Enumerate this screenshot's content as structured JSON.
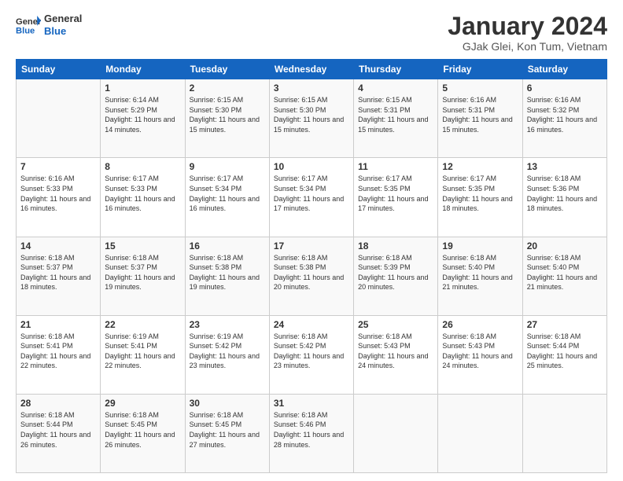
{
  "logo": {
    "line1": "General",
    "line2": "Blue"
  },
  "header": {
    "title": "January 2024",
    "subtitle": "GJak Glei, Kon Tum, Vietnam"
  },
  "weekdays": [
    "Sunday",
    "Monday",
    "Tuesday",
    "Wednesday",
    "Thursday",
    "Friday",
    "Saturday"
  ],
  "weeks": [
    [
      {
        "day": "",
        "sunrise": "",
        "sunset": "",
        "daylight": ""
      },
      {
        "day": "1",
        "sunrise": "6:14 AM",
        "sunset": "5:29 PM",
        "daylight": "11 hours and 14 minutes."
      },
      {
        "day": "2",
        "sunrise": "6:15 AM",
        "sunset": "5:30 PM",
        "daylight": "11 hours and 15 minutes."
      },
      {
        "day": "3",
        "sunrise": "6:15 AM",
        "sunset": "5:30 PM",
        "daylight": "11 hours and 15 minutes."
      },
      {
        "day": "4",
        "sunrise": "6:15 AM",
        "sunset": "5:31 PM",
        "daylight": "11 hours and 15 minutes."
      },
      {
        "day": "5",
        "sunrise": "6:16 AM",
        "sunset": "5:31 PM",
        "daylight": "11 hours and 15 minutes."
      },
      {
        "day": "6",
        "sunrise": "6:16 AM",
        "sunset": "5:32 PM",
        "daylight": "11 hours and 16 minutes."
      }
    ],
    [
      {
        "day": "7",
        "sunrise": "6:16 AM",
        "sunset": "5:33 PM",
        "daylight": "11 hours and 16 minutes."
      },
      {
        "day": "8",
        "sunrise": "6:17 AM",
        "sunset": "5:33 PM",
        "daylight": "11 hours and 16 minutes."
      },
      {
        "day": "9",
        "sunrise": "6:17 AM",
        "sunset": "5:34 PM",
        "daylight": "11 hours and 16 minutes."
      },
      {
        "day": "10",
        "sunrise": "6:17 AM",
        "sunset": "5:34 PM",
        "daylight": "11 hours and 17 minutes."
      },
      {
        "day": "11",
        "sunrise": "6:17 AM",
        "sunset": "5:35 PM",
        "daylight": "11 hours and 17 minutes."
      },
      {
        "day": "12",
        "sunrise": "6:17 AM",
        "sunset": "5:35 PM",
        "daylight": "11 hours and 18 minutes."
      },
      {
        "day": "13",
        "sunrise": "6:18 AM",
        "sunset": "5:36 PM",
        "daylight": "11 hours and 18 minutes."
      }
    ],
    [
      {
        "day": "14",
        "sunrise": "6:18 AM",
        "sunset": "5:37 PM",
        "daylight": "11 hours and 18 minutes."
      },
      {
        "day": "15",
        "sunrise": "6:18 AM",
        "sunset": "5:37 PM",
        "daylight": "11 hours and 19 minutes."
      },
      {
        "day": "16",
        "sunrise": "6:18 AM",
        "sunset": "5:38 PM",
        "daylight": "11 hours and 19 minutes."
      },
      {
        "day": "17",
        "sunrise": "6:18 AM",
        "sunset": "5:38 PM",
        "daylight": "11 hours and 20 minutes."
      },
      {
        "day": "18",
        "sunrise": "6:18 AM",
        "sunset": "5:39 PM",
        "daylight": "11 hours and 20 minutes."
      },
      {
        "day": "19",
        "sunrise": "6:18 AM",
        "sunset": "5:40 PM",
        "daylight": "11 hours and 21 minutes."
      },
      {
        "day": "20",
        "sunrise": "6:18 AM",
        "sunset": "5:40 PM",
        "daylight": "11 hours and 21 minutes."
      }
    ],
    [
      {
        "day": "21",
        "sunrise": "6:18 AM",
        "sunset": "5:41 PM",
        "daylight": "11 hours and 22 minutes."
      },
      {
        "day": "22",
        "sunrise": "6:19 AM",
        "sunset": "5:41 PM",
        "daylight": "11 hours and 22 minutes."
      },
      {
        "day": "23",
        "sunrise": "6:19 AM",
        "sunset": "5:42 PM",
        "daylight": "11 hours and 23 minutes."
      },
      {
        "day": "24",
        "sunrise": "6:18 AM",
        "sunset": "5:42 PM",
        "daylight": "11 hours and 23 minutes."
      },
      {
        "day": "25",
        "sunrise": "6:18 AM",
        "sunset": "5:43 PM",
        "daylight": "11 hours and 24 minutes."
      },
      {
        "day": "26",
        "sunrise": "6:18 AM",
        "sunset": "5:43 PM",
        "daylight": "11 hours and 24 minutes."
      },
      {
        "day": "27",
        "sunrise": "6:18 AM",
        "sunset": "5:44 PM",
        "daylight": "11 hours and 25 minutes."
      }
    ],
    [
      {
        "day": "28",
        "sunrise": "6:18 AM",
        "sunset": "5:44 PM",
        "daylight": "11 hours and 26 minutes."
      },
      {
        "day": "29",
        "sunrise": "6:18 AM",
        "sunset": "5:45 PM",
        "daylight": "11 hours and 26 minutes."
      },
      {
        "day": "30",
        "sunrise": "6:18 AM",
        "sunset": "5:45 PM",
        "daylight": "11 hours and 27 minutes."
      },
      {
        "day": "31",
        "sunrise": "6:18 AM",
        "sunset": "5:46 PM",
        "daylight": "11 hours and 28 minutes."
      },
      {
        "day": "",
        "sunrise": "",
        "sunset": "",
        "daylight": ""
      },
      {
        "day": "",
        "sunrise": "",
        "sunset": "",
        "daylight": ""
      },
      {
        "day": "",
        "sunrise": "",
        "sunset": "",
        "daylight": ""
      }
    ]
  ]
}
